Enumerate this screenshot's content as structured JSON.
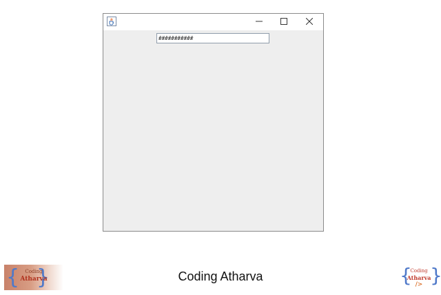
{
  "window": {
    "text_field_value": "###########",
    "minimize_glyph": "–",
    "maximize_glyph": "☐",
    "close_glyph": "✕"
  },
  "footer": {
    "title": "Coding Atharva"
  },
  "logo": {
    "line1": "Coding",
    "line2": "Atharva",
    "tag": "/>"
  },
  "colors": {
    "window_bg": "#eeeeee",
    "titlebar_bg": "#ffffff",
    "brace_blue": "#4f79c9",
    "logo_red": "#c0392b",
    "logo_orange": "#d35400"
  },
  "icons": {
    "app": "java-cup-icon",
    "minimize": "minimize-icon",
    "maximize": "maximize-icon",
    "close": "close-icon"
  }
}
